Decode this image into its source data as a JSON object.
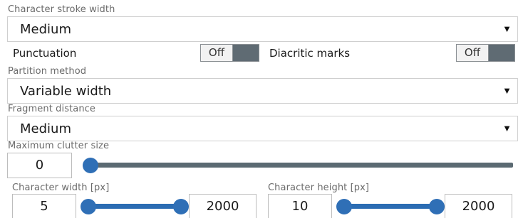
{
  "stroke_width": {
    "label": "Character stroke width",
    "value": "Medium"
  },
  "punctuation": {
    "label": "Punctuation",
    "toggle": "Off"
  },
  "diacritics": {
    "label": "Diacritic marks",
    "toggle": "Off"
  },
  "partition": {
    "label": "Partition method",
    "value": "Variable width"
  },
  "fragment": {
    "label": "Fragment distance",
    "value": "Medium"
  },
  "clutter": {
    "label": "Maximum clutter size",
    "value": "0"
  },
  "char_width": {
    "label": "Character width [px]",
    "min": "5",
    "max": "2000"
  },
  "char_height": {
    "label": "Character height [px]",
    "min": "10",
    "max": "2000"
  },
  "arrow_glyph": "▼",
  "colors": {
    "accent": "#2f6fb6",
    "track": "#5b6a72",
    "toggle_bg": "#5f6b73"
  }
}
